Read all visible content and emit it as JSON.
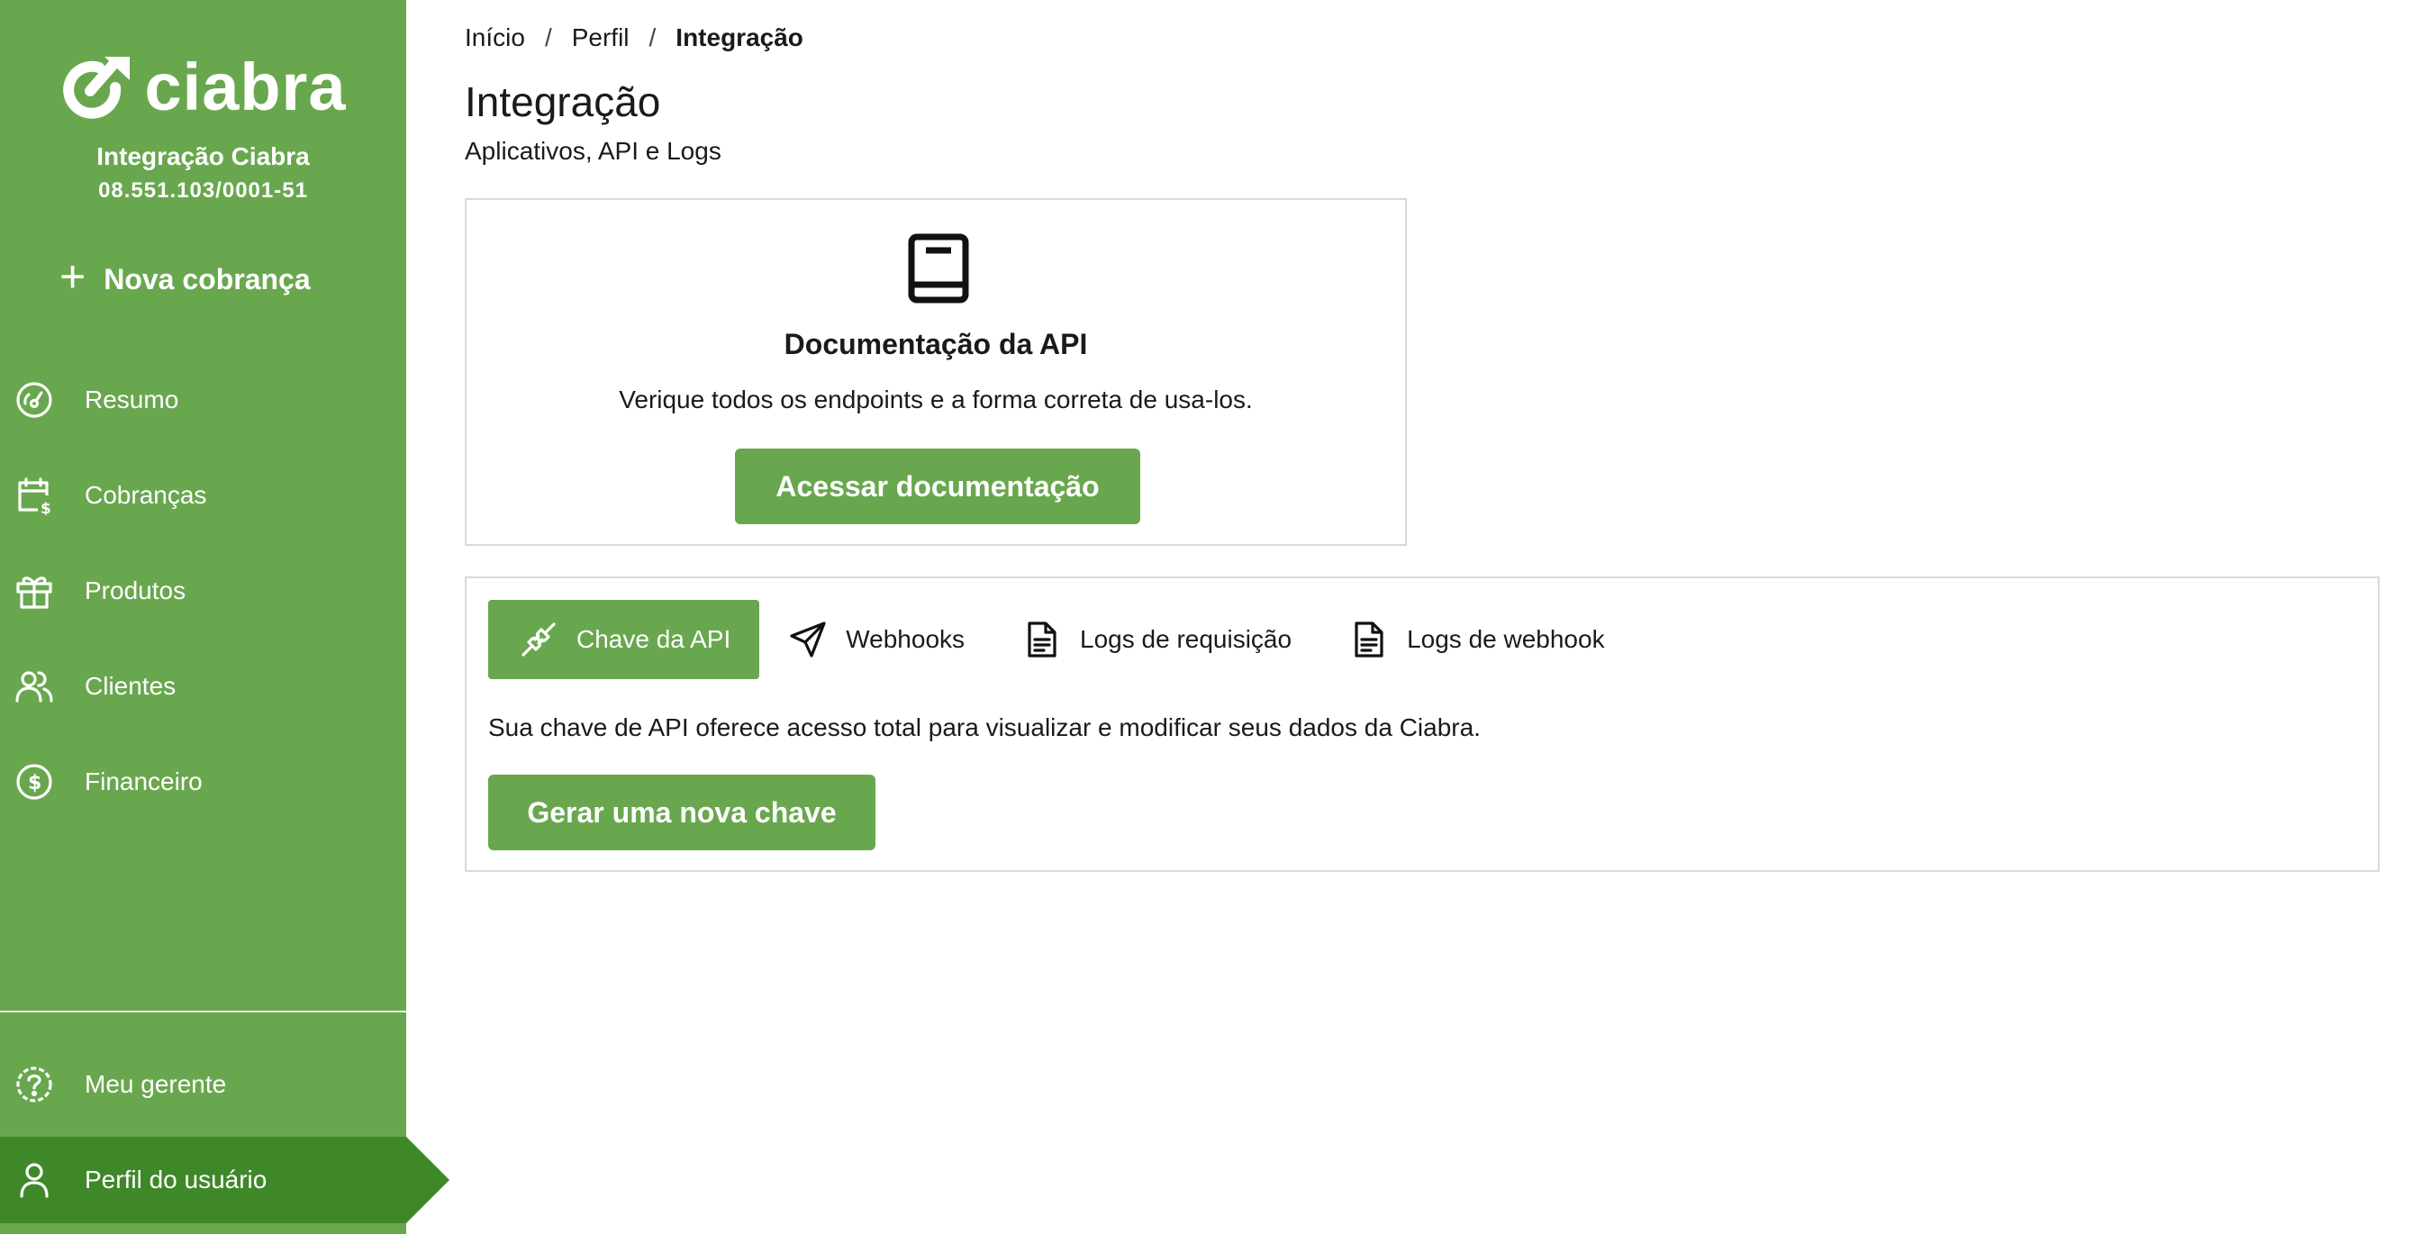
{
  "sidebar": {
    "brand_name": "ciabra",
    "org_name": "Integração Ciabra",
    "org_id": "08.551.103/0001-51",
    "new_charge_label": "Nova cobrança",
    "items": [
      {
        "label": "Resumo",
        "icon": "gauge-icon"
      },
      {
        "label": "Cobranças",
        "icon": "calendar-dollar-icon"
      },
      {
        "label": "Produtos",
        "icon": "gift-icon"
      },
      {
        "label": "Clientes",
        "icon": "users-icon"
      },
      {
        "label": "Financeiro",
        "icon": "dollar-circle-icon"
      }
    ],
    "bottom_items": [
      {
        "label": "Meu gerente",
        "icon": "help-circle-icon"
      },
      {
        "label": "Perfil do usuário",
        "icon": "user-icon",
        "active": true
      }
    ],
    "colors": {
      "background": "#69a74f",
      "active": "#3f8829"
    }
  },
  "breadcrumb": {
    "items": [
      "Início",
      "Perfil",
      "Integração"
    ],
    "separator": "/"
  },
  "page": {
    "title": "Integração",
    "subtitle": "Aplicativos, API e Logs"
  },
  "doc_card": {
    "icon": "book-icon",
    "title": "Documentação da API",
    "description": "Verique todos os endpoints e a forma correta de usa-los.",
    "button_label": "Acessar documentação"
  },
  "api_card": {
    "tabs": [
      {
        "label": "Chave da API",
        "icon": "plug-icon",
        "active": true
      },
      {
        "label": "Webhooks",
        "icon": "send-icon"
      },
      {
        "label": "Logs de requisição",
        "icon": "file-text-icon"
      },
      {
        "label": "Logs de webhook",
        "icon": "file-text-icon"
      }
    ],
    "description": "Sua chave de API oferece acesso total para visualizar e modificar seus dados da Ciabra.",
    "button_label": "Gerar uma nova chave"
  },
  "accent_color": "#69a74f"
}
